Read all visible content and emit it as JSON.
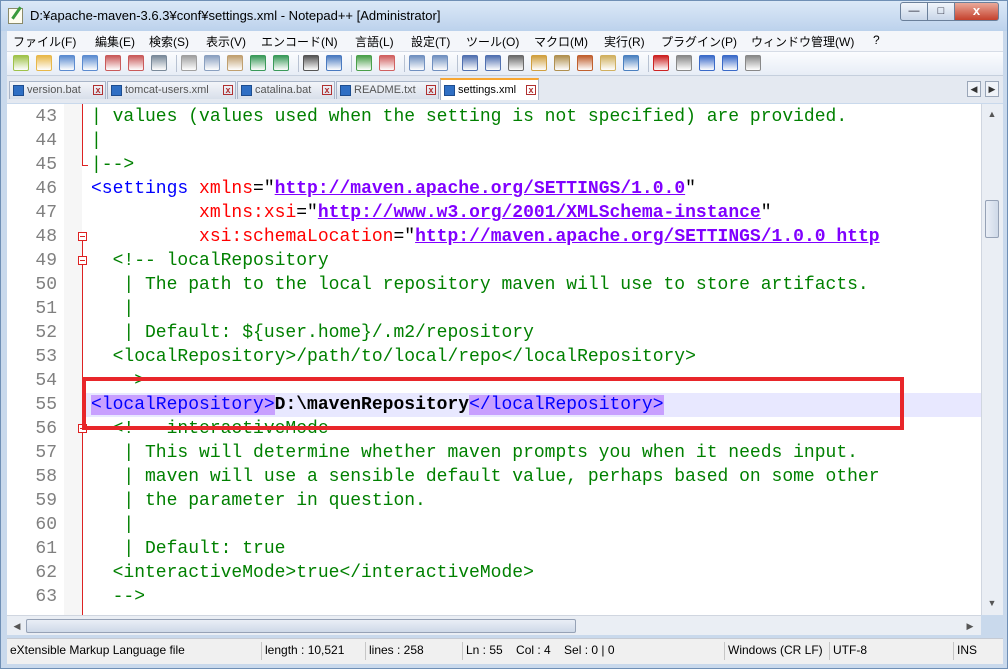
{
  "window": {
    "title": "D:¥apache-maven-3.6.3¥conf¥settings.xml - Notepad++ [Administrator]",
    "minimize": "—",
    "maximize": "□",
    "close": "x"
  },
  "menu": [
    "ファイル(F)",
    "編集(E)",
    "検索(S)",
    "表示(V)",
    "エンコード(N)",
    "言語(L)",
    "設定(T)",
    "ツール(O)",
    "マクロ(M)",
    "実行(R)",
    "プラグイン(P)",
    "ウィンドウ管理(W)",
    "?"
  ],
  "toolbar_icons": [
    "new-file-icon",
    "open-file-icon",
    "save-icon",
    "save-all-icon",
    "close-icon",
    "close-all-icon",
    "print-icon",
    "cut-icon",
    "copy-icon",
    "paste-icon",
    "undo-icon",
    "redo-icon",
    "find-icon",
    "replace-icon",
    "zoom-in-icon",
    "zoom-out-icon",
    "sync-vertical-icon",
    "sync-horizontal-icon",
    "word-wrap-icon",
    "show-all-chars-icon",
    "indent-guide-icon",
    "udl-icon",
    "doc-map-icon",
    "function-list-icon",
    "folder-workspace-icon",
    "monitoring-icon",
    "record-macro-icon",
    "stop-macro-icon",
    "play-macro-icon",
    "run-macro-multiple-icon",
    "save-macro-icon"
  ],
  "tabs": [
    {
      "label": "version.bat",
      "close": "x",
      "active": false
    },
    {
      "label": "tomcat-users.xml",
      "close": "x",
      "active": false
    },
    {
      "label": "catalina.bat",
      "close": "x",
      "active": false
    },
    {
      "label": "README.txt",
      "close": "x",
      "active": false
    },
    {
      "label": "settings.xml",
      "close": "x",
      "active": true
    }
  ],
  "tab_nav": {
    "left": "◀",
    "right": "▶"
  },
  "editor": {
    "lines": [
      {
        "num": "43",
        "segments": [
          {
            "c": "cm",
            "t": "| values (values used when the setting is not specified) are provided."
          }
        ]
      },
      {
        "num": "44",
        "segments": [
          {
            "c": "cm",
            "t": "|"
          }
        ]
      },
      {
        "num": "45",
        "segments": [
          {
            "c": "cm",
            "t": "|-->"
          }
        ]
      },
      {
        "num": "46",
        "segments": [
          {
            "c": "tag",
            "t": "<settings "
          },
          {
            "c": "attr",
            "t": "xmlns"
          },
          {
            "c": "txt",
            "t": "=\""
          },
          {
            "c": "val",
            "t": "http://maven.apache.org/SETTINGS/1.0.0"
          },
          {
            "c": "txt",
            "t": "\""
          }
        ]
      },
      {
        "num": "47",
        "segments": [
          {
            "c": "txt",
            "t": "          "
          },
          {
            "c": "attr",
            "t": "xmlns:xsi"
          },
          {
            "c": "txt",
            "t": "=\""
          },
          {
            "c": "val",
            "t": "http://www.w3.org/2001/XMLSchema-instance"
          },
          {
            "c": "txt",
            "t": "\""
          }
        ]
      },
      {
        "num": "48",
        "segments": [
          {
            "c": "txt",
            "t": "          "
          },
          {
            "c": "attr",
            "t": "xsi:schemaLocation"
          },
          {
            "c": "txt",
            "t": "=\""
          },
          {
            "c": "val",
            "t": "http://maven.apache.org/SETTINGS/1.0.0 http"
          }
        ]
      },
      {
        "num": "49",
        "segments": [
          {
            "c": "cm",
            "t": "  <!-- localRepository"
          }
        ]
      },
      {
        "num": "50",
        "segments": [
          {
            "c": "cm",
            "t": "   | The path to the local repository maven will use to store artifacts."
          }
        ]
      },
      {
        "num": "51",
        "segments": [
          {
            "c": "cm",
            "t": "   |"
          }
        ]
      },
      {
        "num": "52",
        "segments": [
          {
            "c": "cm",
            "t": "   | Default: ${user.home}/.m2/repository"
          }
        ]
      },
      {
        "num": "53",
        "segments": [
          {
            "c": "cm",
            "t": "  <localRepository>/path/to/local/repo</localRepository>"
          }
        ]
      },
      {
        "num": "54",
        "segments": [
          {
            "c": "cm",
            "t": "  -->"
          }
        ]
      },
      {
        "num": "55",
        "segments": [
          {
            "c": "match",
            "t": "<localRepository>"
          },
          {
            "c": "strong",
            "t": "D:\\mavenRepository"
          },
          {
            "c": "match",
            "t": "</localRepository>"
          }
        ]
      },
      {
        "num": "56",
        "segments": [
          {
            "c": "cm",
            "t": "  <!-- interactiveMode"
          }
        ]
      },
      {
        "num": "57",
        "segments": [
          {
            "c": "cm",
            "t": "   | This will determine whether maven prompts you when it needs input."
          }
        ]
      },
      {
        "num": "58",
        "segments": [
          {
            "c": "cm",
            "t": "   | maven will use a sensible default value, perhaps based on some other"
          }
        ]
      },
      {
        "num": "59",
        "segments": [
          {
            "c": "cm",
            "t": "   | the parameter in question."
          }
        ]
      },
      {
        "num": "60",
        "segments": [
          {
            "c": "cm",
            "t": "   |"
          }
        ]
      },
      {
        "num": "61",
        "segments": [
          {
            "c": "cm",
            "t": "   | Default: true"
          }
        ]
      },
      {
        "num": "62",
        "segments": [
          {
            "c": "cm",
            "t": "  <interactiveMode>true</interactiveMode>"
          }
        ]
      },
      {
        "num": "63",
        "segments": [
          {
            "c": "cm",
            "t": "  -->"
          }
        ]
      }
    ]
  },
  "scroll": {
    "up": "▲",
    "down": "▼",
    "left": "◀",
    "right": "▶"
  },
  "status": {
    "file_type": "eXtensible Markup Language file",
    "length": "length : 10,521",
    "lines": "lines : 258",
    "position": "Ln : 55    Col : 4    Sel : 0 | 0",
    "eol": "Windows (CR LF)",
    "encoding": "UTF-8",
    "mode": "INS"
  },
  "colors": {
    "comment": "#008000",
    "tag": "#0000ff",
    "attribute": "#ff0000",
    "value": "#8000ff",
    "annotation": "#e8262a",
    "current_line": "#e8e8ff",
    "match": "#c8a0ff"
  }
}
